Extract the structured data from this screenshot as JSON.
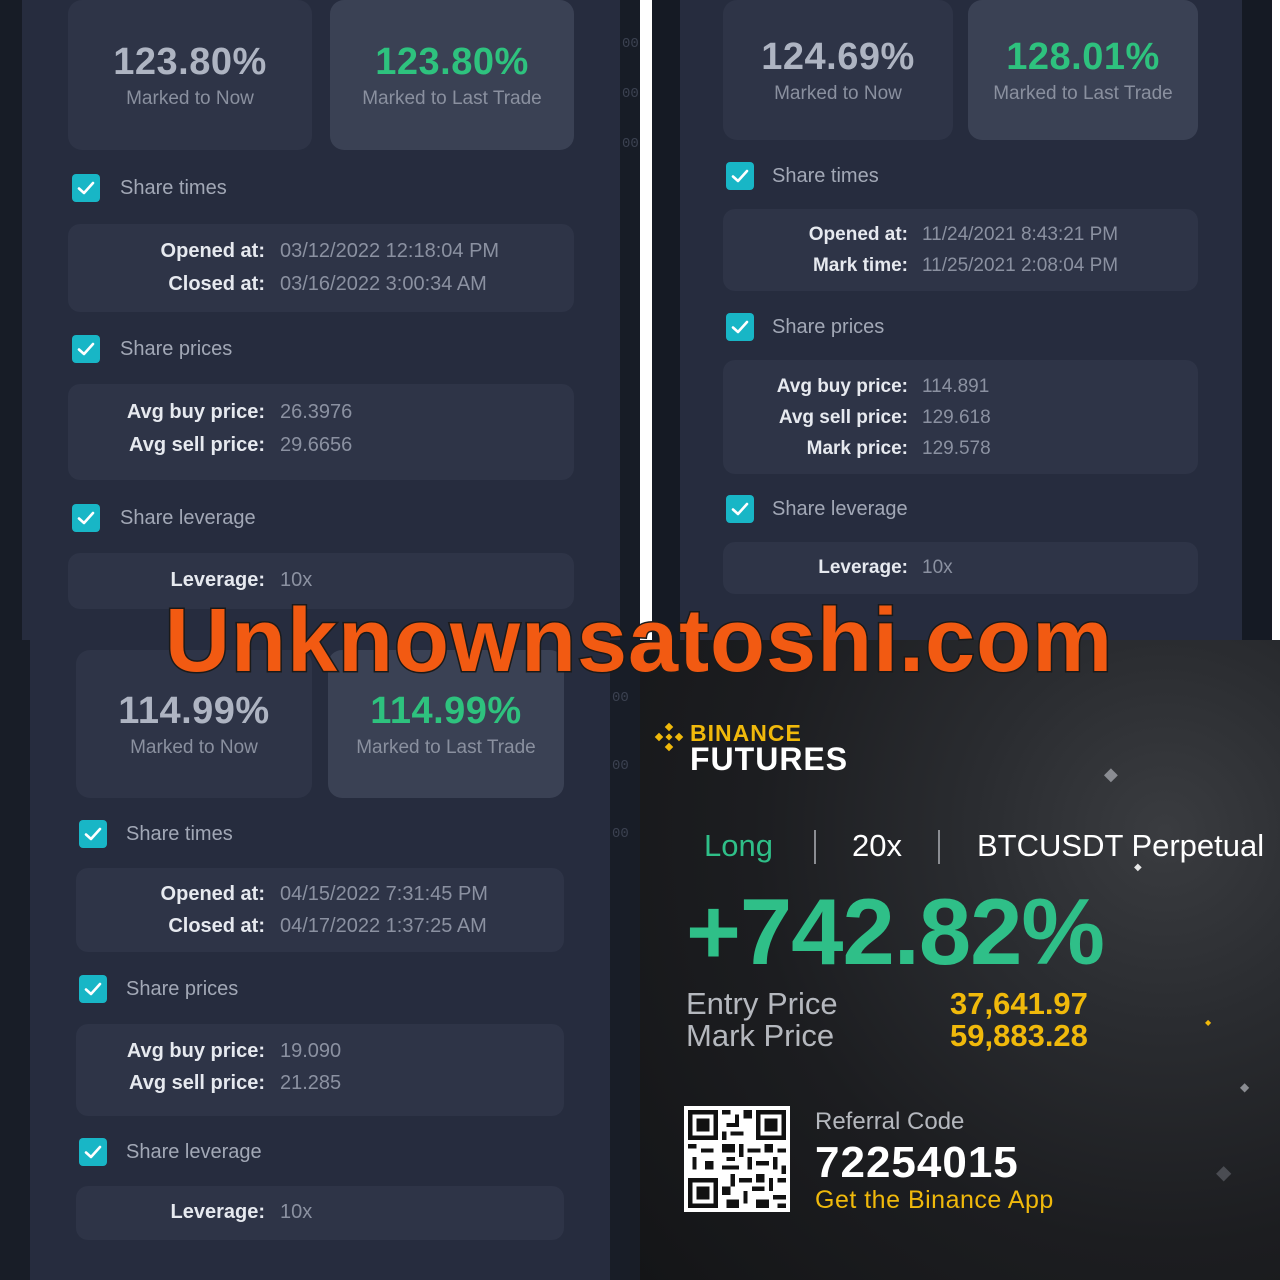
{
  "watermark": "Unknownsatoshi.com",
  "check_icon": "checkmark-icon",
  "colors": {
    "green": "#2ec27e",
    "check": "#18b6c6",
    "binance_yellow": "#f0b90b",
    "watermark": "#f25a12"
  },
  "tl": {
    "marked_now_pct": "123.80%",
    "marked_now_label": "Marked to Now",
    "marked_last_pct": "123.80%",
    "marked_last_label": "Marked to Last Trade",
    "share_times": "Share times",
    "opened_label": "Opened at:",
    "opened_value": "03/12/2022 12:18:04 PM",
    "closed_label": "Closed at:",
    "closed_value": "03/16/2022 3:00:34 AM",
    "share_prices": "Share prices",
    "avg_buy_label": "Avg buy price:",
    "avg_buy_value": "26.3976",
    "avg_sell_label": "Avg sell price:",
    "avg_sell_value": "29.6656",
    "share_leverage": "Share leverage",
    "leverage_label": "Leverage:",
    "leverage_value": "10x"
  },
  "tr": {
    "marked_now_pct": "124.69%",
    "marked_now_label": "Marked to Now",
    "marked_last_pct": "128.01%",
    "marked_last_label": "Marked to Last Trade",
    "share_times": "Share times",
    "opened_label": "Opened at:",
    "opened_value": "11/24/2021 8:43:21 PM",
    "mark_time_label": "Mark time:",
    "mark_time_value": "11/25/2021 2:08:04 PM",
    "share_prices": "Share prices",
    "avg_buy_label": "Avg buy price:",
    "avg_buy_value": "114.891",
    "avg_sell_label": "Avg sell price:",
    "avg_sell_value": "129.618",
    "mark_price_label": "Mark price:",
    "mark_price_value": "129.578",
    "share_leverage": "Share leverage",
    "leverage_label": "Leverage:",
    "leverage_value": "10x"
  },
  "bl": {
    "marked_now_pct": "114.99%",
    "marked_now_label": "Marked to Now",
    "marked_last_pct": "114.99%",
    "marked_last_label": "Marked to Last Trade",
    "share_times": "Share times",
    "opened_label": "Opened at:",
    "opened_value": "04/15/2022 7:31:45 PM",
    "closed_label": "Closed at:",
    "closed_value": "04/17/2022 1:37:25 AM",
    "share_prices": "Share prices",
    "avg_buy_label": "Avg buy price:",
    "avg_buy_value": "19.090",
    "avg_sell_label": "Avg sell price:",
    "avg_sell_value": "21.285",
    "share_leverage": "Share leverage",
    "leverage_label": "Leverage:",
    "leverage_value": "10x"
  },
  "binance": {
    "logo_icon": "binance-logo-icon",
    "brand": "BINANCE",
    "product": "FUTURES",
    "side": "Long",
    "leverage": "20x",
    "symbol": "BTCUSDT Perpetual",
    "roe": "+742.82%",
    "entry_label": "Entry Price",
    "entry_value": "37,641.97",
    "mark_label": "Mark Price",
    "mark_value": "59,883.28",
    "referral_label": "Referral Code",
    "referral_code": "72254015",
    "app_text": "Get the Binance App",
    "qr_icon": "qr-code-icon"
  }
}
